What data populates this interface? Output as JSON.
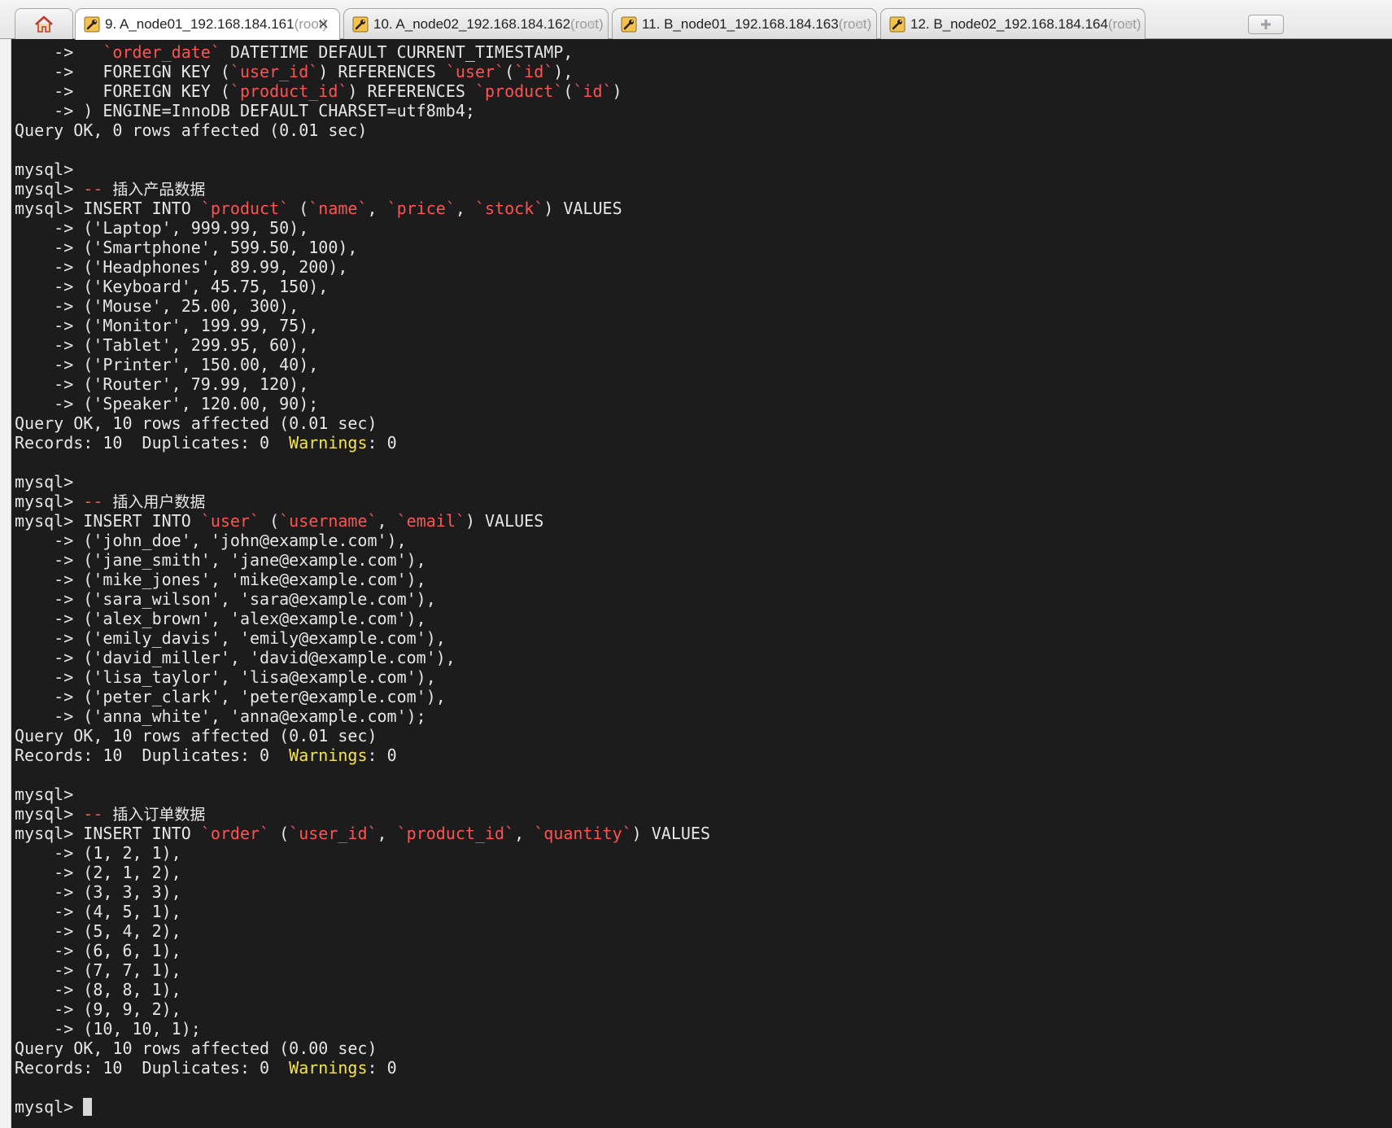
{
  "tabs": [
    {
      "number": "9.",
      "title": "A_node01_192.168.184.161",
      "suffix": "(root)",
      "active": true
    },
    {
      "number": "10.",
      "title": "A_node02_192.168.184.162",
      "suffix": "(root)",
      "active": false
    },
    {
      "number": "11.",
      "title": "B_node01_192.168.184.163",
      "suffix": "(root)",
      "active": false
    },
    {
      "number": "12.",
      "title": "B_node02_192.168.184.164",
      "suffix": "(root)",
      "active": false
    }
  ],
  "colors": {
    "background": "#1c1c1c",
    "text": "#e6e6e6",
    "identifier": "#ff5252",
    "warning": "#f5e44a"
  },
  "icons": {
    "home": "home-icon",
    "tab": "terminal-wrench-icon",
    "new_tab": "new-tab-icon"
  },
  "terminal": {
    "lines": [
      [
        {
          "t": "    ->   "
        },
        {
          "t": "`order_date`",
          "c": "red"
        },
        {
          "t": " DATETIME DEFAULT CURRENT_TIMESTAMP,"
        }
      ],
      [
        {
          "t": "    ->   FOREIGN KEY ("
        },
        {
          "t": "`user_id`",
          "c": "red"
        },
        {
          "t": ") REFERENCES "
        },
        {
          "t": "`user`",
          "c": "red"
        },
        {
          "t": "("
        },
        {
          "t": "`id`",
          "c": "red"
        },
        {
          "t": "),"
        }
      ],
      [
        {
          "t": "    ->   FOREIGN KEY ("
        },
        {
          "t": "`product_id`",
          "c": "red"
        },
        {
          "t": ") REFERENCES "
        },
        {
          "t": "`product`",
          "c": "red"
        },
        {
          "t": "("
        },
        {
          "t": "`id`",
          "c": "red"
        },
        {
          "t": ")"
        }
      ],
      [
        {
          "t": "    -> ) ENGINE=InnoDB DEFAULT CHARSET=utf8mb4;"
        }
      ],
      [
        {
          "t": "Query OK, 0 rows affected (0.01 sec)"
        }
      ],
      [],
      [
        {
          "t": "mysql>"
        }
      ],
      [
        {
          "t": "mysql> "
        },
        {
          "t": "-- ",
          "c": "red"
        },
        {
          "t": "插入产品数据",
          "c": "cjk"
        }
      ],
      [
        {
          "t": "mysql> INSERT INTO "
        },
        {
          "t": "`product`",
          "c": "red"
        },
        {
          "t": " ("
        },
        {
          "t": "`name`",
          "c": "red"
        },
        {
          "t": ", "
        },
        {
          "t": "`price`",
          "c": "red"
        },
        {
          "t": ", "
        },
        {
          "t": "`stock`",
          "c": "red"
        },
        {
          "t": ") VALUES"
        }
      ],
      [
        {
          "t": "    -> ('Laptop', 999.99, 50),"
        }
      ],
      [
        {
          "t": "    -> ('Smartphone', 599.50, 100),"
        }
      ],
      [
        {
          "t": "    -> ('Headphones', 89.99, 200),"
        }
      ],
      [
        {
          "t": "    -> ('Keyboard', 45.75, 150),"
        }
      ],
      [
        {
          "t": "    -> ('Mouse', 25.00, 300),"
        }
      ],
      [
        {
          "t": "    -> ('Monitor', 199.99, 75),"
        }
      ],
      [
        {
          "t": "    -> ('Tablet', 299.95, 60),"
        }
      ],
      [
        {
          "t": "    -> ('Printer', 150.00, 40),"
        }
      ],
      [
        {
          "t": "    -> ('Router', 79.99, 120),"
        }
      ],
      [
        {
          "t": "    -> ('Speaker', 120.00, 90);"
        }
      ],
      [
        {
          "t": "Query OK, 10 rows affected (0.01 sec)"
        }
      ],
      [
        {
          "t": "Records: 10  Duplicates: 0  "
        },
        {
          "t": "Warnings",
          "c": "yellow"
        },
        {
          "t": ": 0"
        }
      ],
      [],
      [
        {
          "t": "mysql>"
        }
      ],
      [
        {
          "t": "mysql> "
        },
        {
          "t": "-- ",
          "c": "red"
        },
        {
          "t": "插入用户数据",
          "c": "cjk"
        }
      ],
      [
        {
          "t": "mysql> INSERT INTO "
        },
        {
          "t": "`user`",
          "c": "red"
        },
        {
          "t": " ("
        },
        {
          "t": "`username`",
          "c": "red"
        },
        {
          "t": ", "
        },
        {
          "t": "`email`",
          "c": "red"
        },
        {
          "t": ") VALUES"
        }
      ],
      [
        {
          "t": "    -> ('john_doe', 'john@example.com'),"
        }
      ],
      [
        {
          "t": "    -> ('jane_smith', 'jane@example.com'),"
        }
      ],
      [
        {
          "t": "    -> ('mike_jones', 'mike@example.com'),"
        }
      ],
      [
        {
          "t": "    -> ('sara_wilson', 'sara@example.com'),"
        }
      ],
      [
        {
          "t": "    -> ('alex_brown', 'alex@example.com'),"
        }
      ],
      [
        {
          "t": "    -> ('emily_davis', 'emily@example.com'),"
        }
      ],
      [
        {
          "t": "    -> ('david_miller', 'david@example.com'),"
        }
      ],
      [
        {
          "t": "    -> ('lisa_taylor', 'lisa@example.com'),"
        }
      ],
      [
        {
          "t": "    -> ('peter_clark', 'peter@example.com'),"
        }
      ],
      [
        {
          "t": "    -> ('anna_white', 'anna@example.com');"
        }
      ],
      [
        {
          "t": "Query OK, 10 rows affected (0.01 sec)"
        }
      ],
      [
        {
          "t": "Records: 10  Duplicates: 0  "
        },
        {
          "t": "Warnings",
          "c": "yellow"
        },
        {
          "t": ": 0"
        }
      ],
      [],
      [
        {
          "t": "mysql>"
        }
      ],
      [
        {
          "t": "mysql> "
        },
        {
          "t": "-- ",
          "c": "red"
        },
        {
          "t": "插入订单数据",
          "c": "cjk"
        }
      ],
      [
        {
          "t": "mysql> INSERT INTO "
        },
        {
          "t": "`order`",
          "c": "red"
        },
        {
          "t": " ("
        },
        {
          "t": "`user_id`",
          "c": "red"
        },
        {
          "t": ", "
        },
        {
          "t": "`product_id`",
          "c": "red"
        },
        {
          "t": ", "
        },
        {
          "t": "`quantity`",
          "c": "red"
        },
        {
          "t": ") VALUES"
        }
      ],
      [
        {
          "t": "    -> (1, 2, 1),"
        }
      ],
      [
        {
          "t": "    -> (2, 1, 2),"
        }
      ],
      [
        {
          "t": "    -> (3, 3, 3),"
        }
      ],
      [
        {
          "t": "    -> (4, 5, 1),"
        }
      ],
      [
        {
          "t": "    -> (5, 4, 2),"
        }
      ],
      [
        {
          "t": "    -> (6, 6, 1),"
        }
      ],
      [
        {
          "t": "    -> (7, 7, 1),"
        }
      ],
      [
        {
          "t": "    -> (8, 8, 1),"
        }
      ],
      [
        {
          "t": "    -> (9, 9, 2),"
        }
      ],
      [
        {
          "t": "    -> (10, 10, 1);"
        }
      ],
      [
        {
          "t": "Query OK, 10 rows affected (0.00 sec)"
        }
      ],
      [
        {
          "t": "Records: 10  Duplicates: 0  "
        },
        {
          "t": "Warnings",
          "c": "yellow"
        },
        {
          "t": ": 0"
        }
      ],
      [],
      [
        {
          "t": "mysql> "
        },
        {
          "cursor": true
        }
      ]
    ]
  }
}
